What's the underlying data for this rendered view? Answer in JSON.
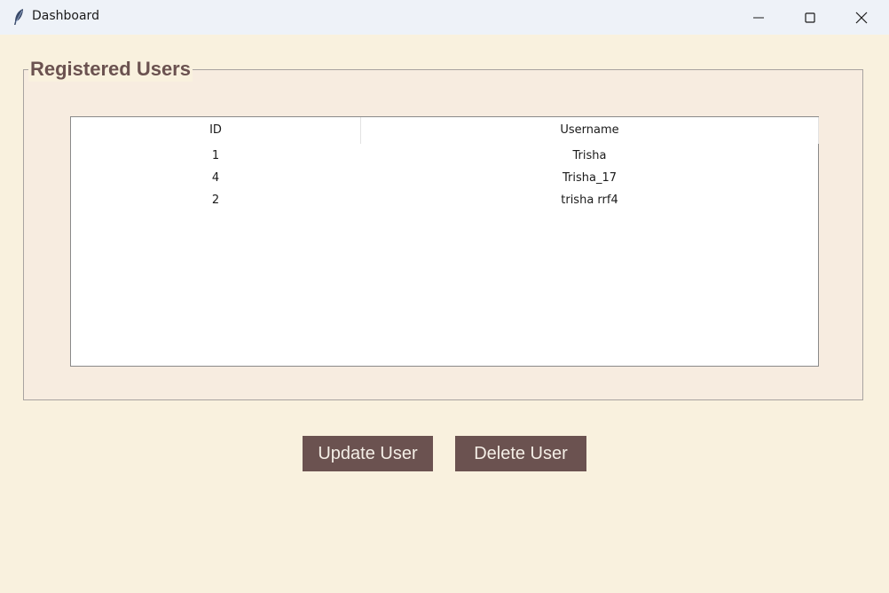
{
  "window": {
    "title": "Dashboard"
  },
  "group": {
    "title": "Registered Users"
  },
  "table": {
    "columns": [
      "ID",
      "Username"
    ],
    "rows": [
      {
        "id": "1",
        "username": "Trisha"
      },
      {
        "id": "4",
        "username": "Trisha_17"
      },
      {
        "id": "2",
        "username": "trisha rrf4"
      }
    ]
  },
  "buttons": {
    "update_label": "Update User",
    "delete_label": "Delete User"
  },
  "colors": {
    "background": "#f9f1de",
    "accent": "#6b5250",
    "titlebar": "#eef2f8"
  }
}
